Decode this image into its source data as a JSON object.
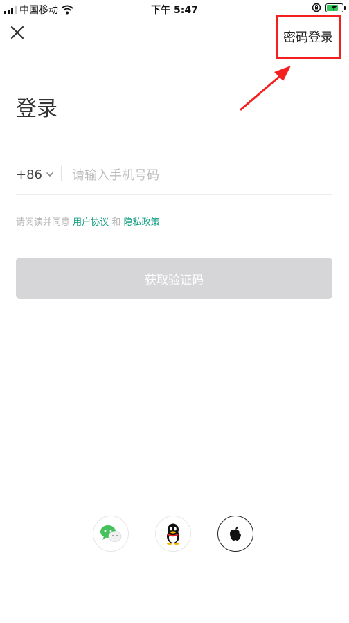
{
  "status_bar": {
    "carrier": "中国移动",
    "time": "下午 5:47",
    "battery_level": 0.8,
    "icons": [
      "signal-icon",
      "wifi-icon",
      "rotation-lock-icon",
      "battery-charging-icon"
    ]
  },
  "header": {
    "close_icon": "close-icon",
    "password_login": "密码登录"
  },
  "main": {
    "title": "登录",
    "country_code": "+86",
    "phone_placeholder": "请输入手机号码",
    "agreement_prefix": "请阅读并同意",
    "user_agreement": "用户协议",
    "and": "和",
    "privacy_policy": "隐私政策",
    "get_code_button": "获取验证码"
  },
  "social_login": {
    "items": [
      "wechat-icon",
      "qq-icon",
      "apple-icon"
    ]
  },
  "colors": {
    "link": "#17a085",
    "button_disabled": "#d6d6d8",
    "annotation": "#f41f1f"
  }
}
